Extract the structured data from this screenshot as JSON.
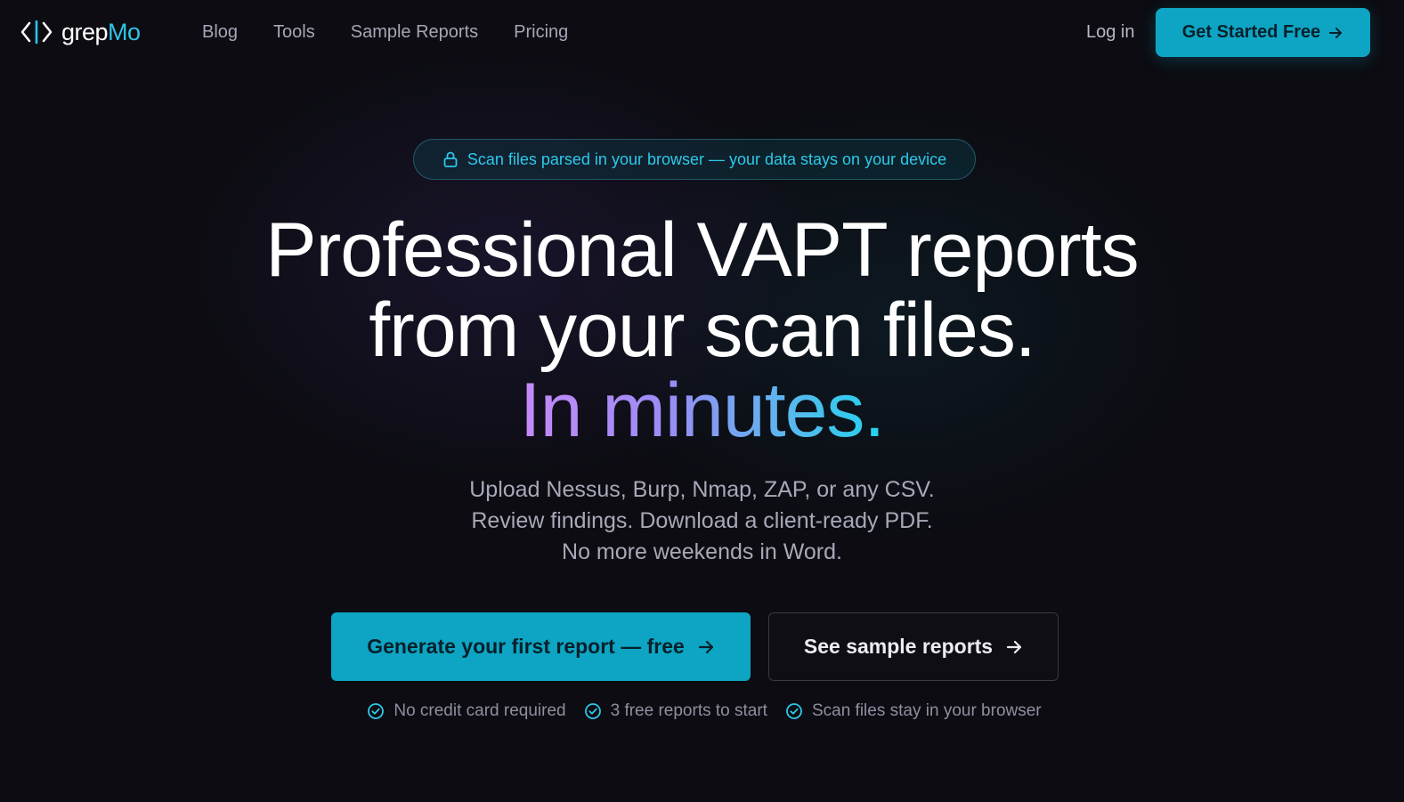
{
  "brand": {
    "name_part1": "grep",
    "name_part2": "Mo",
    "accent_color": "#2ec4e6",
    "logo_icon": "code-brackets-icon"
  },
  "nav": {
    "links": [
      "Blog",
      "Tools",
      "Sample Reports",
      "Pricing"
    ],
    "login_label": "Log in",
    "cta_label": "Get Started Free",
    "cta_icon": "arrow-right-icon"
  },
  "badge": {
    "icon": "lock-icon",
    "text": "Scan files parsed in your browser — your data stays on your device"
  },
  "hero": {
    "line1": "Professional VAPT reports",
    "line2": "from your scan files.",
    "line3": "In minutes."
  },
  "subtitle": {
    "line1": "Upload Nessus, Burp, Nmap, ZAP, or any CSV.",
    "line2": "Review findings. Download a client-ready PDF.",
    "line3": "No more weekends in Word."
  },
  "buttons": {
    "primary_label": "Generate your first report — free",
    "secondary_label": "See sample reports",
    "primary_color": "#0ea5c4"
  },
  "checks": [
    {
      "icon": "check-circle-icon",
      "text": "No credit card required"
    },
    {
      "icon": "check-circle-icon",
      "text": "3 free reports to start"
    },
    {
      "icon": "check-circle-icon",
      "text": "Scan files stay in your browser"
    }
  ]
}
